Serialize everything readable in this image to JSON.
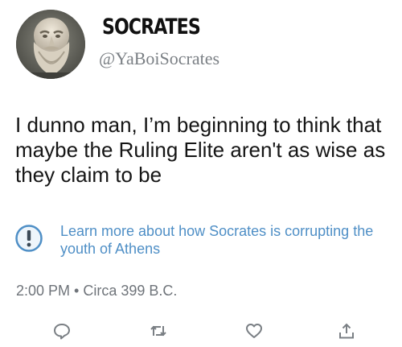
{
  "tweet": {
    "display_name": "SOCRATES",
    "handle": "@YaBoiSocrates",
    "text": "I dunno man, I’m beginning to think that maybe the Ruling Elite aren't as wise as they claim to be",
    "notice": {
      "icon": "exclamation-circle-icon",
      "text": "Learn more about how Socrates is corrupting the youth of Athens"
    },
    "time": "2:00 PM",
    "separator": "•",
    "date": "Circa 399 B.C.",
    "actions": [
      {
        "icon": "reply-icon"
      },
      {
        "icon": "retweet-icon"
      },
      {
        "icon": "heart-icon"
      },
      {
        "icon": "share-icon"
      }
    ]
  },
  "colors": {
    "link": "#4f8fc6",
    "secondary_text": "#7a7f84",
    "action_icons": "#7a7f84"
  }
}
